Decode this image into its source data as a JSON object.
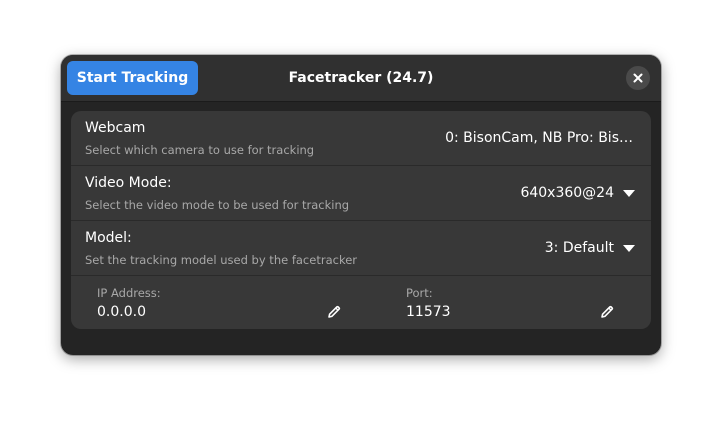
{
  "header": {
    "start_label": "Start Tracking",
    "title": "Facetracker (24.7)",
    "close_icon": "close-icon"
  },
  "rows": {
    "webcam": {
      "title": "Webcam",
      "subtitle": "Select which camera to use for tracking",
      "value": "0: BisonCam, NB Pro: Bis…"
    },
    "video_mode": {
      "title": "Video Mode:",
      "subtitle": "Select the video mode to be used for tracking",
      "value": "640x360@24"
    },
    "model": {
      "title": "Model:",
      "subtitle": "Set the tracking model used by the facetracker",
      "value": "3: Default"
    }
  },
  "network": {
    "ip_label": "IP Address:",
    "ip_value": "0.0.0.0",
    "port_label": "Port:",
    "port_value": "11573"
  },
  "colors": {
    "accent": "#3584e4",
    "window_bg": "#242424",
    "list_bg": "#383838",
    "header_bg": "#303030"
  }
}
